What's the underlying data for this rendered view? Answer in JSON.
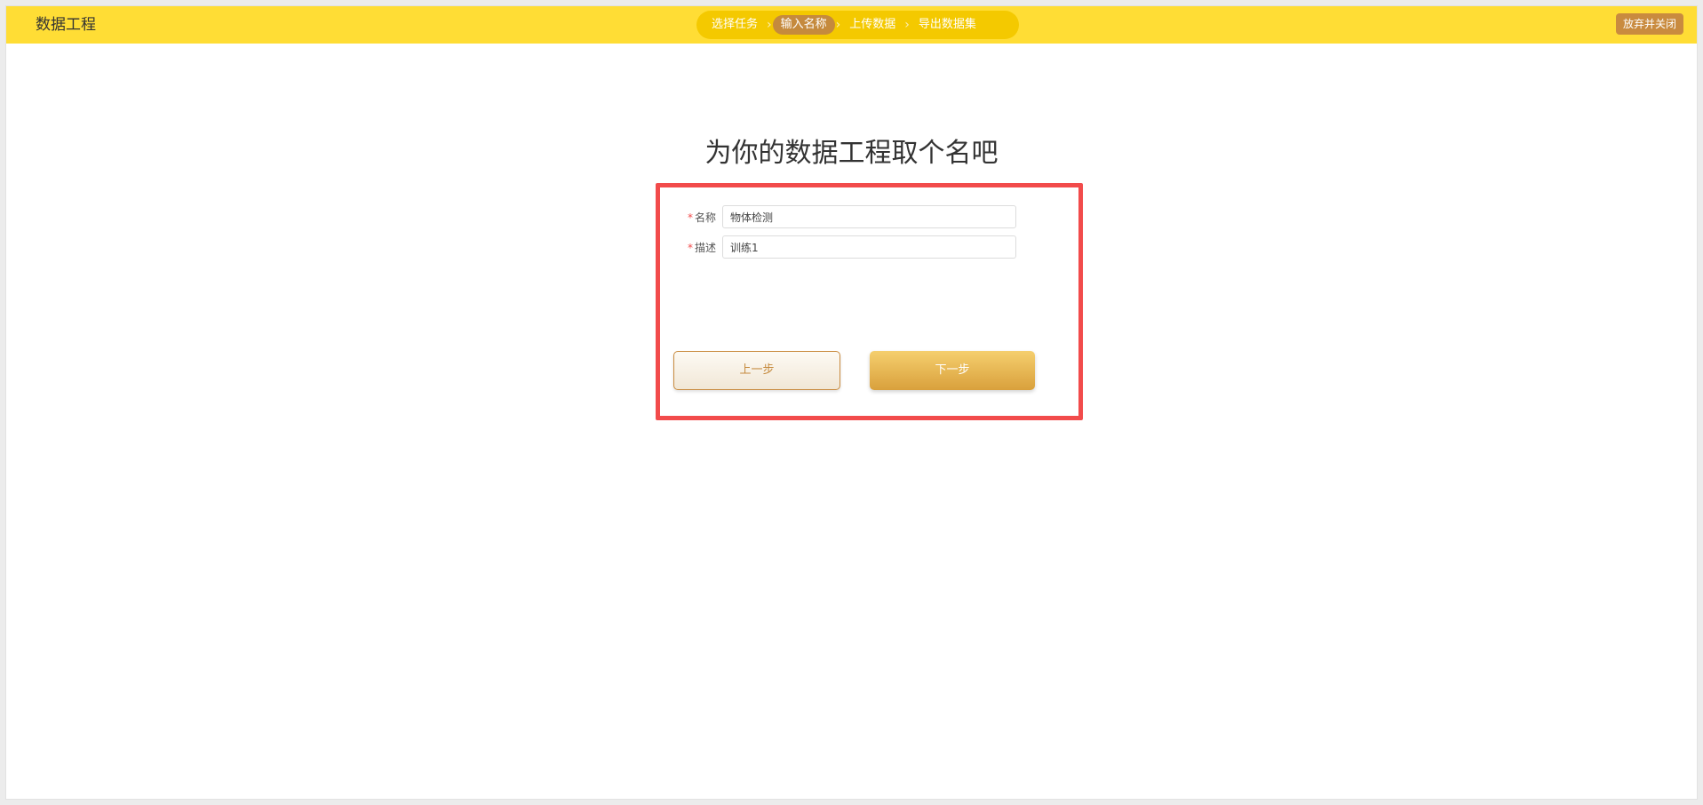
{
  "app": {
    "title": "数据工程"
  },
  "steps": [
    {
      "label": "选择任务",
      "active": false
    },
    {
      "label": "输入名称",
      "active": true
    },
    {
      "label": "上传数据",
      "active": false
    },
    {
      "label": "导出数据集",
      "active": false
    }
  ],
  "header": {
    "close_label": "放弃并关闭"
  },
  "main": {
    "heading": "为你的数据工程取个名吧",
    "form": {
      "required_mark": "*",
      "name_label": "名称",
      "name_value": "物体检测",
      "desc_label": "描述",
      "desc_value": "训练1"
    },
    "buttons": {
      "prev_label": "上一步",
      "next_label": "下一步"
    }
  },
  "colors": {
    "topbar": "#ffdd35",
    "steps_track": "#f4c900",
    "accent": "#c58a3d",
    "highlight_border": "#f24b4b"
  }
}
